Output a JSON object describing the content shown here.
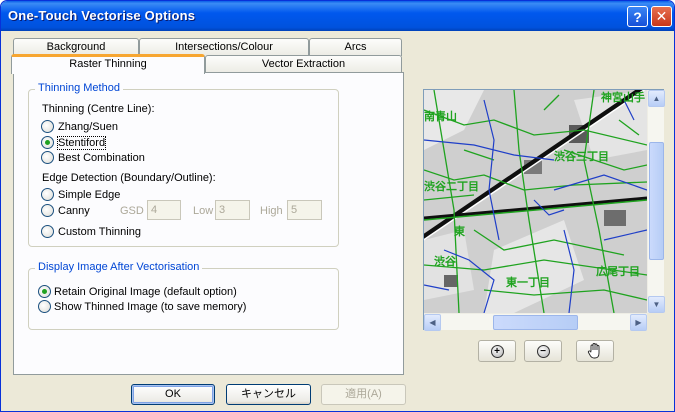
{
  "window": {
    "title": "One-Touch Vectorise Options",
    "help_glyph": "?",
    "close_glyph": "✕"
  },
  "tabs": {
    "row1": [
      "Background",
      "Intersections/Colour",
      "Arcs"
    ],
    "row2": [
      "Raster Thinning",
      "Vector Extraction"
    ],
    "active": "Raster Thinning"
  },
  "thinning_method": {
    "group_title": "Thinning Method",
    "centre_line_label": "Thinning (Centre Line):",
    "options": [
      {
        "label": "Zhang/Suen",
        "checked": false
      },
      {
        "label": "Stentiford",
        "checked": true
      },
      {
        "label": "Best Combination",
        "checked": false
      }
    ],
    "edge_label": "Edge Detection (Boundary/Outline):",
    "simple_edge": "Simple Edge",
    "canny": "Canny",
    "gsd_label": "GSD",
    "gsd_value": "4",
    "low_label": "Low",
    "low_value": "3",
    "high_label": "High",
    "high_value": "5",
    "custom": "Custom Thinning"
  },
  "display_image": {
    "group_title": "Display Image After Vectorisation",
    "options": [
      {
        "label": "Retain Original Image (default option)",
        "checked": true
      },
      {
        "label": "Show Thinned Image (to save memory)",
        "checked": false
      }
    ]
  },
  "map": {
    "labels": [
      "神宮山手",
      "渋谷二丁目",
      "渋谷三丁目",
      "南青山",
      "東一丁目",
      "広尾丁目",
      "渋谷",
      "東"
    ]
  },
  "toolbar": {
    "zoom_in_icon": "zoom-in-icon",
    "zoom_out_icon": "zoom-out-icon",
    "pan_icon": "hand-pan-icon"
  },
  "buttons": {
    "ok": "OK",
    "cancel": "キャンセル",
    "apply": "適用(A)"
  },
  "colors": {
    "title_bar": "#0054e3",
    "group_title": "#0046d5",
    "map_lines_green": "#1fa31f",
    "map_lines_blue": "#1f3fc8"
  }
}
